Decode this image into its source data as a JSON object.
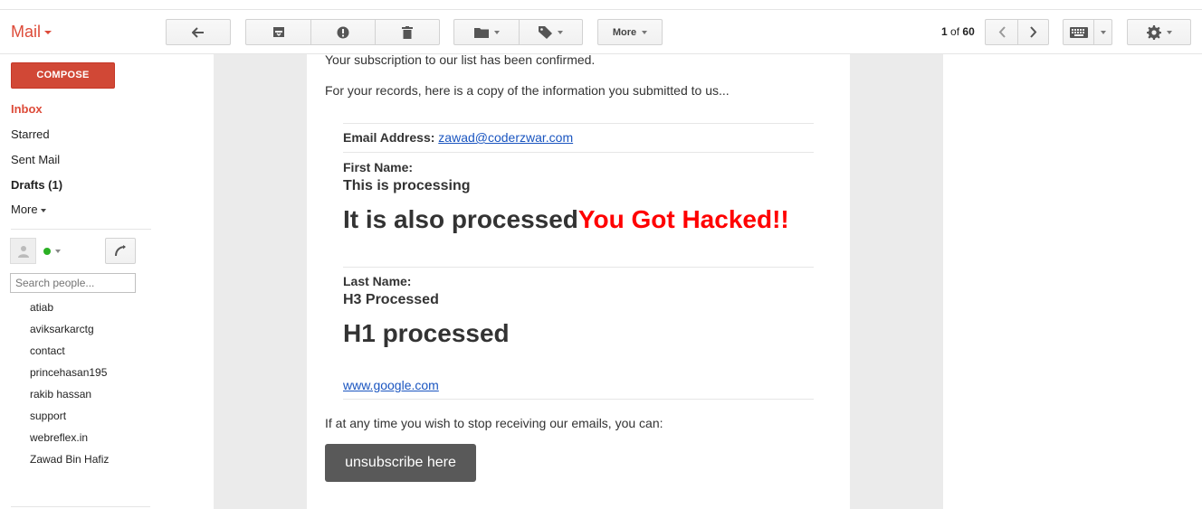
{
  "header": {
    "app_label": "Mail",
    "more_label": "More",
    "pager": {
      "current": "1",
      "of": "of",
      "total": "60"
    }
  },
  "sidebar": {
    "compose_label": "COMPOSE",
    "items": [
      {
        "label": "Inbox"
      },
      {
        "label": "Starred"
      },
      {
        "label": "Sent Mail"
      },
      {
        "label": "Drafts (1)"
      },
      {
        "label": "More"
      }
    ],
    "search_placeholder": "Search people...",
    "contacts": [
      "atiab",
      "aviksarkarctg",
      "contact",
      "princehasan195",
      "rakib hassan",
      "support",
      "webreflex.in",
      "Zawad Bin Hafiz"
    ]
  },
  "email": {
    "intro_1": "Your subscription to our list has been confirmed.",
    "intro_2": "For your records, here is a copy of the information you submitted to us...",
    "email_label": "Email Address:",
    "email_value": "zawad@coderzwar.com",
    "first_name_label": "First Name:",
    "first_h3": "This is processing",
    "first_h1": "It is also processed",
    "first_h1_hacked": "You Got Hacked!!",
    "last_name_label": "Last Name:",
    "last_h3": "H3 Processed",
    "last_h1": "H1 processed",
    "link": "www.google.com",
    "footer_text": "If at any time you wish to stop receiving our emails, you can:",
    "unsubscribe_label": "unsubscribe here"
  },
  "colors": {
    "accent": "#dd4b39",
    "compose": "#d14836",
    "hacked": "#ff0000",
    "link": "#1a55c0",
    "unsubscribe": "#595959",
    "online": "#2bb024"
  }
}
